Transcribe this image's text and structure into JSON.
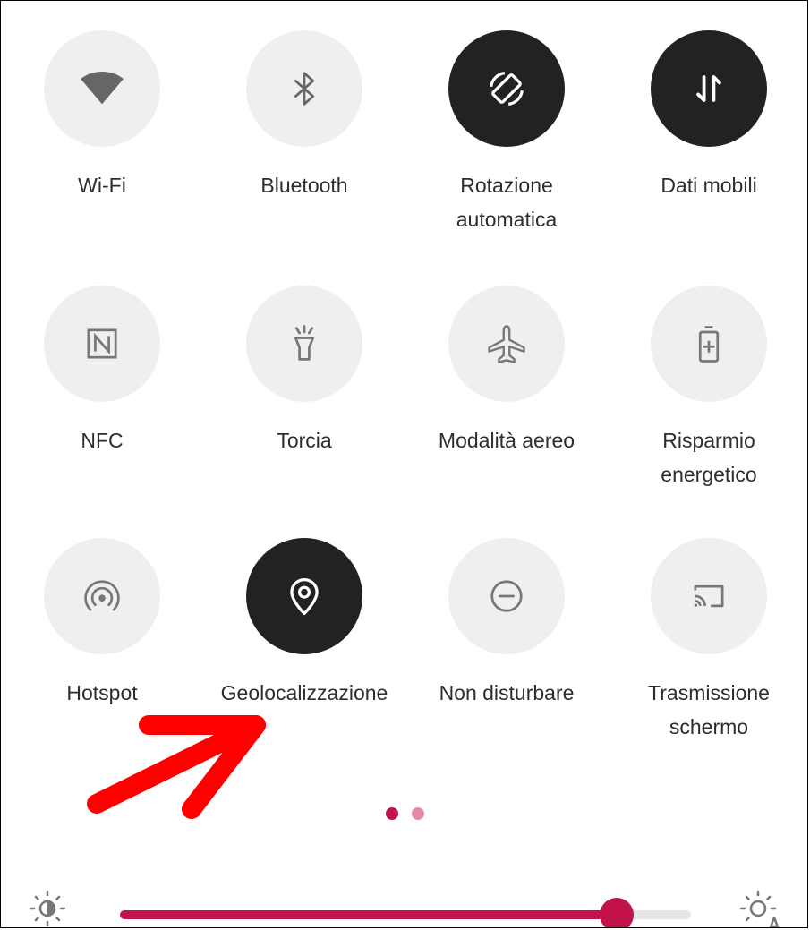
{
  "tiles": [
    {
      "label": "Wi-Fi",
      "icon": "wifi-icon",
      "active": false
    },
    {
      "label": "Bluetooth",
      "icon": "bluetooth-icon",
      "active": false
    },
    {
      "label": "Rotazione automatica",
      "icon": "auto-rotate-icon",
      "active": true
    },
    {
      "label": "Dati mobili",
      "icon": "mobile-data-icon",
      "active": true
    },
    {
      "label": "NFC",
      "icon": "nfc-icon",
      "active": false
    },
    {
      "label": "Torcia",
      "icon": "flashlight-icon",
      "active": false
    },
    {
      "label": "Modalità aereo",
      "icon": "airplane-icon",
      "active": false
    },
    {
      "label": "Risparmio energetico",
      "icon": "battery-saver-icon",
      "active": false
    },
    {
      "label": "Hotspot",
      "icon": "hotspot-icon",
      "active": false
    },
    {
      "label": "Geolocalizzazione",
      "icon": "location-icon",
      "active": true
    },
    {
      "label": "Non disturbare",
      "icon": "do-not-disturb-icon",
      "active": false
    },
    {
      "label": "Trasmissione schermo",
      "icon": "cast-icon",
      "active": false
    }
  ],
  "pager": {
    "current_page": 1,
    "total_pages": 2
  },
  "brightness": {
    "level_fraction": 0.87
  },
  "colors": {
    "accent": "#c2134a",
    "accent_light": "#e58aa5",
    "tile_off": "#efefef",
    "tile_on": "#222222",
    "annotation_arrow": "#ff0000"
  },
  "icons": {
    "brightness_left": "brightness-icon",
    "brightness_right": "auto-brightness-icon",
    "annotation": "red-arrow-icon"
  }
}
